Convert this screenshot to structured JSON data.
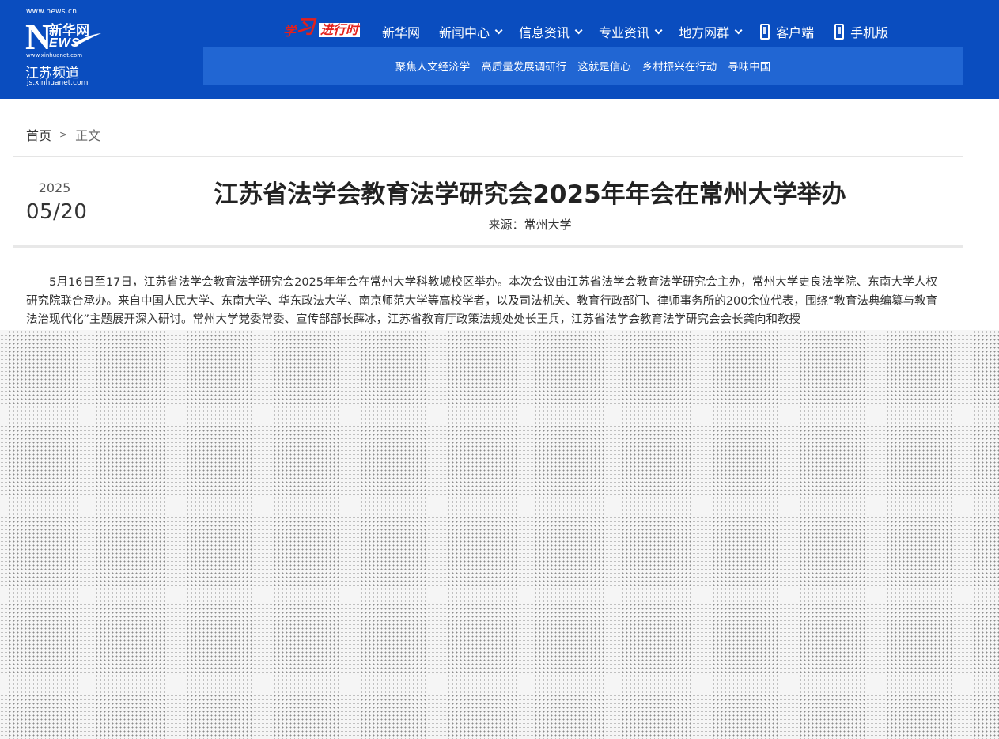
{
  "logo": {
    "url_top": "www.news.cn",
    "brand_letter": "N",
    "brand_cn": "新华网",
    "brand_ews": "EWS",
    "url_mid": "www.xinhuanet.com",
    "channel": "江苏频道",
    "url_bot": "js.xinhuanet.com"
  },
  "special_logo": {
    "char_xue": "学",
    "char_xi": "习",
    "suffix": "进行时"
  },
  "nav": {
    "items": [
      {
        "label": "新华网",
        "has_dropdown": false
      },
      {
        "label": "新闻中心",
        "has_dropdown": true
      },
      {
        "label": "信息资讯",
        "has_dropdown": true
      },
      {
        "label": "专业资讯",
        "has_dropdown": true
      },
      {
        "label": "地方网群",
        "has_dropdown": true
      }
    ],
    "client": "客户端",
    "mobile": "手机版"
  },
  "subnav": {
    "items": [
      "聚焦人文经济学",
      "高质量发展调研行",
      "这就是信心",
      "乡村振兴在行动",
      "寻味中国"
    ]
  },
  "breadcrumb": {
    "home": "首页",
    "separator": ">",
    "current": "正文"
  },
  "article": {
    "year": "2025",
    "month_day": "05/20",
    "title": "江苏省法学会教育法学研究会2025年年会在常州大学举办",
    "source": "来源：常州大学",
    "body": "5月16日至17日，江苏省法学会教育法学研究会2025年年会在常州大学科教城校区举办。本次会议由江苏省法学会教育法学研究会主办，常州大学史良法学院、东南大学人权研究院联合承办。来自中国人民大学、东南大学、华东政法大学、南京师范大学等高校学者，以及司法机关、教育行政部门、律师事务所的200余位代表，围绕“教育法典编纂与教育法治现代化”主题展开深入研讨。常州大学党委常委、宣传部部长薛冰，江苏省教育厅政策法规处处长王兵，江苏省法学会教育法学研究会会长龚向和教授"
  },
  "colors": {
    "header_bg": "#0a4dbf",
    "subnav_bg": "#2166d3",
    "accent_red": "#e4201c"
  }
}
